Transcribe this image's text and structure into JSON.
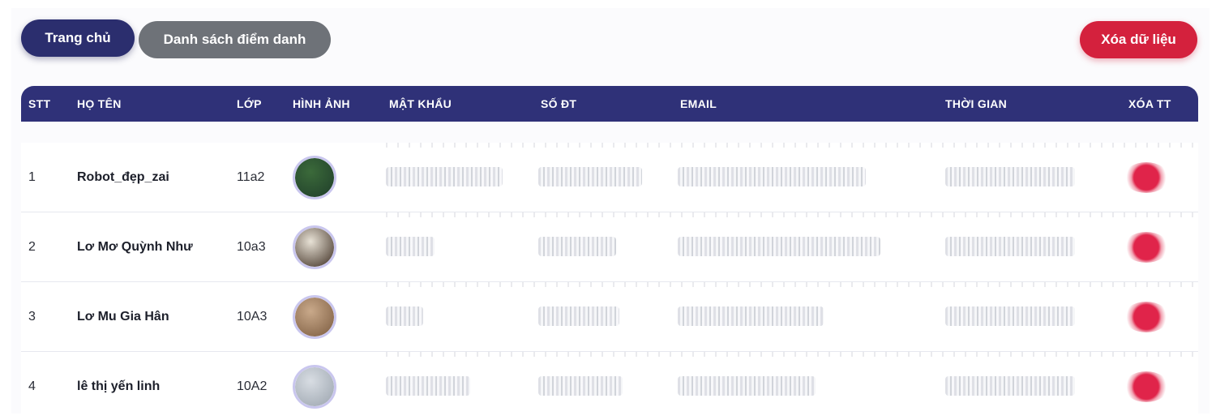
{
  "toolbar": {
    "home_label": "Trang chủ",
    "list_label": "Danh sách điểm danh",
    "clear_label": "Xóa dữ liệu"
  },
  "table": {
    "headers": {
      "stt": "STT",
      "name": "HỌ TÊN",
      "class": "LỚP",
      "image": "HÌNH ẢNH",
      "password": "MẬT KHẨU",
      "phone": "SỐ ĐT",
      "email": "EMAIL",
      "time": "THỜI GIAN",
      "delete": "XÓA TT"
    },
    "rows": [
      {
        "stt": "1",
        "name": "Robot_đẹp_zai",
        "class": "11a2",
        "avatar_colors": [
          "#3b6a3a",
          "#1f3d2a"
        ]
      },
      {
        "stt": "2",
        "name": "Lơ Mơ Quỳnh Như",
        "class": "10a3",
        "avatar_colors": [
          "#e8e2d6",
          "#3a2a1e"
        ]
      },
      {
        "stt": "3",
        "name": "Lơ Mu Gia Hân",
        "class": "10A3",
        "avatar_colors": [
          "#c9a98a",
          "#7a5a3e"
        ]
      },
      {
        "stt": "4",
        "name": "lê thị yến linh",
        "class": "10A2",
        "avatar_colors": [
          "#d8dde3",
          "#9aa3ad"
        ]
      }
    ]
  },
  "colors": {
    "primary": "#2f3178",
    "danger": "#d4213d",
    "secondary": "#6e7278"
  }
}
